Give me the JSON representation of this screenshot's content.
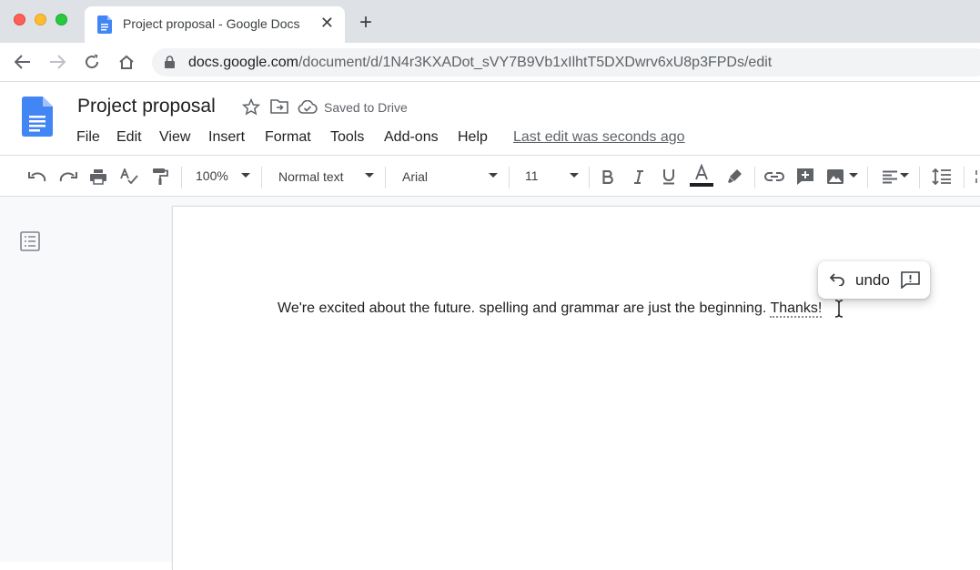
{
  "browser": {
    "tab_title": "Project proposal - Google Docs",
    "close_glyph": "✕",
    "newtab_glyph": "+",
    "url_host": "docs.google.com",
    "url_path": "/document/d/1N4r3KXADot_sVY7B9Vb1xIlhtT5DXDwrv6xU8p3FPDs/edit"
  },
  "doc": {
    "title": "Project proposal",
    "saved_status": "Saved to Drive",
    "last_edit": "Last edit was seconds ago"
  },
  "menu": [
    "File",
    "Edit",
    "View",
    "Insert",
    "Format",
    "Tools",
    "Add-ons",
    "Help"
  ],
  "toolbar": {
    "zoom": "100%",
    "style": "Normal text",
    "font": "Arial",
    "font_size": "11"
  },
  "body": {
    "text_before": "We're excited about the future. spelling and grammar are just the beginning. ",
    "text_corrected": "Thanks!"
  },
  "undo_popup": {
    "label": "undo"
  },
  "colors": {
    "docs_blue": "#4285f4",
    "text_color_bar": "#202124"
  }
}
